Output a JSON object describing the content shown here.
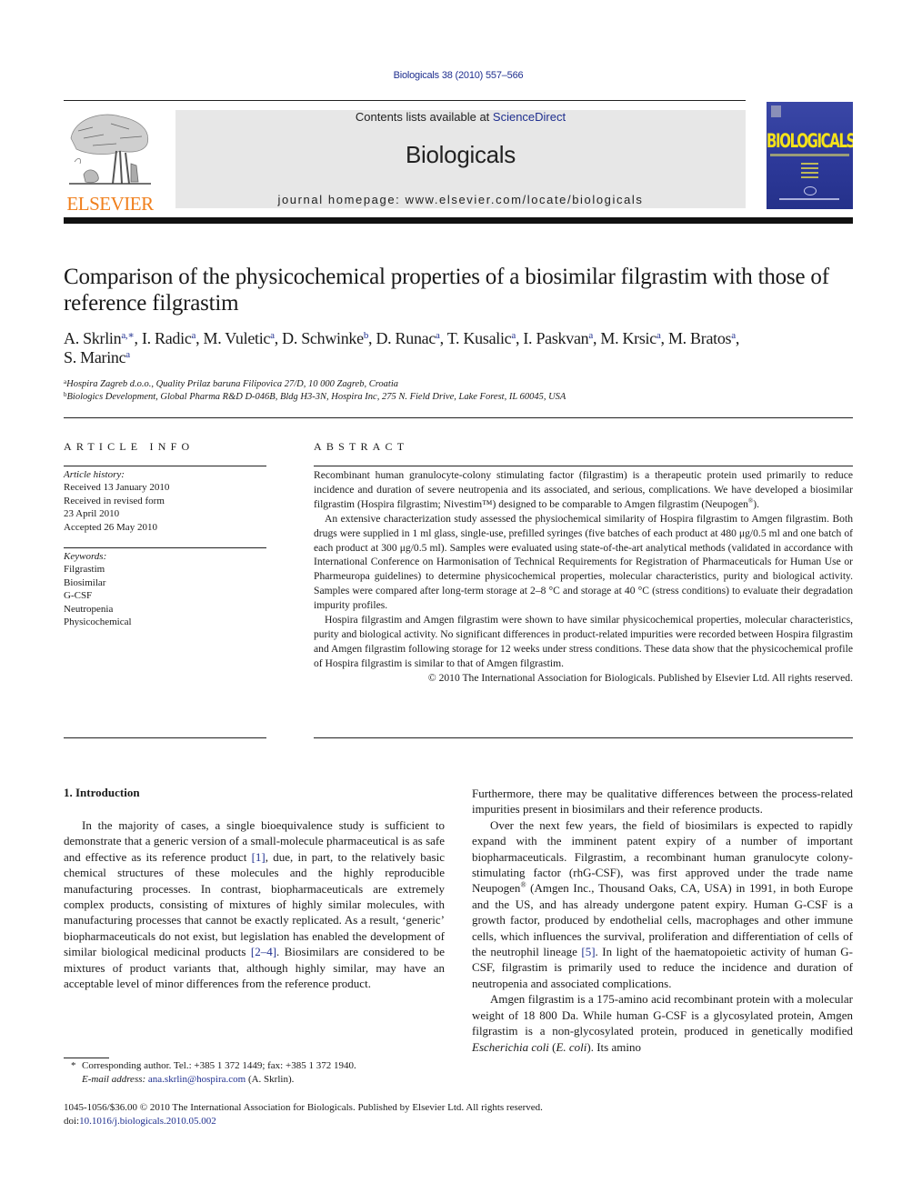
{
  "header": {
    "citation": "Biologicals 38 (2010) 557–566",
    "contents_prefix": "Contents lists available at ",
    "contents_link": "ScienceDirect",
    "journal_title": "Biologicals",
    "homepage": "journal homepage: www.elsevier.com/locate/biologicals",
    "publisher_logo_text": "ELSEVIER",
    "cover_title": "BIOLOGICALS"
  },
  "article": {
    "title": "Comparison of the physicochemical properties of a biosimilar filgrastim with those of reference filgrastim",
    "authors": [
      {
        "name": "A. Skrlin",
        "sup": "a,∗"
      },
      {
        "name": "I. Radic",
        "sup": "a"
      },
      {
        "name": "M. Vuletic",
        "sup": "a"
      },
      {
        "name": "D. Schwinke",
        "sup": "b"
      },
      {
        "name": "D. Runac",
        "sup": "a"
      },
      {
        "name": "T. Kusalic",
        "sup": "a"
      },
      {
        "name": "I. Paskvan",
        "sup": "a"
      },
      {
        "name": "M. Krsic",
        "sup": "a"
      },
      {
        "name": "M. Bratos",
        "sup": "a"
      },
      {
        "name": "S. Marinc",
        "sup": "a"
      }
    ],
    "affiliations": [
      {
        "mark": "a",
        "text": "Hospira Zagreb d.o.o., Quality Prilaz baruna Filipovica 27/D, 10 000 Zagreb, Croatia"
      },
      {
        "mark": "b",
        "text": "Biologics Development, Global Pharma R&D D-046B, Bldg H3-3N, Hospira Inc, 275 N. Field Drive, Lake Forest, IL 60045, USA"
      }
    ]
  },
  "article_info": {
    "heading": "ARTICLE INFO",
    "history_label": "Article history:",
    "history": [
      "Received 13 January 2010",
      "Received in revised form",
      "23 April 2010",
      "Accepted 26 May 2010"
    ],
    "keywords_label": "Keywords:",
    "keywords": [
      "Filgrastim",
      "Biosimilar",
      "G-CSF",
      "Neutropenia",
      "Physicochemical"
    ]
  },
  "abstract": {
    "heading": "ABSTRACT",
    "p1": "Recombinant human granulocyte-colony stimulating factor (filgrastim) is a therapeutic protein used primarily to reduce incidence and duration of severe neutropenia and its associated, and serious, complications. We have developed a biosimilar filgrastim (Hospira filgrastim; Nivestim™) designed to be comparable to Amgen filgrastim (Neupogen",
    "p1_reg": "®",
    "p1_end": ").",
    "p2": "An extensive characterization study assessed the physiochemical similarity of Hospira filgrastim to Amgen filgrastim. Both drugs were supplied in 1 ml glass, single-use, prefilled syringes (five batches of each product at 480 μg/0.5 ml and one batch of each product at 300 μg/0.5 ml). Samples were evaluated using state-of-the-art analytical methods (validated in accordance with International Conference on Harmonisation of Technical Requirements for Registration of Pharmaceuticals for Human Use or Phar­meuropa guidelines) to determine physicochemical properties, molecular characteristics, purity and biological activity. Samples were compared after long-term storage at 2–8 °C and storage at 40 °C (stress conditions) to evaluate their degradation impurity profiles.",
    "p3": "Hospira filgrastim and Amgen filgrastim were shown to have similar physicochemical properties, molecular characteristics, purity and biological activity. No significant differences in product-related impurities were recorded between Hospira filgrastim and Amgen filgrastim following storage for 12 weeks under stress conditions. These data show that the physicochemical profile of Hospira filgrastim is similar to that of Amgen filgrastim.",
    "copyright": "© 2010 The International Association for Biologicals. Published by Elsevier Ltd. All rights reserved."
  },
  "body": {
    "section_heading": "1.  Introduction",
    "col1_p1_a": "In the majority of cases, a single bioequivalence study is suffi­cient to demonstrate that a generic version of a small-molecule pharmaceutical is as safe and effective as its reference product ",
    "ref1": "[1]",
    "col1_p1_b": ", due, in part, to the relatively basic chemical structures of these molecules and the highly reproducible manufacturing processes. In contrast, biopharmaceuticals are extremely complex products, consisting of mixtures of highly similar molecules, with manufacturing processes that cannot be exactly replicated. As a result, ‘generic’ biopharmaceuticals do not exist, but legislation has enabled the development of similar biological medicinal products ",
    "ref2": "[2–4]",
    "col1_p1_c": ". Biosimilars are considered to be mixtures of product variants that, although highly similar, may have an acceptable level of minor differences from the reference product.",
    "col2_p0": "Furthermore, there may be qualitative differences between the process-related impurities present in biosimilars and their refer­ence products.",
    "col2_p1_a": "Over the next few years, the field of biosimilars is expected to rapidly expand with the imminent patent expiry of a number of important biopharmaceuticals. Filgrastim, a recombinant human granulocyte colony-stimulating factor (rhG-CSF), was first approved under the trade name Neupogen",
    "col2_p1_reg": "®",
    "col2_p1_b": " (Amgen Inc., Thousand Oaks, CA, USA) in 1991, in both Europe and the US, and has already undergone patent expiry. Human G-CSF is a growth factor, produced by endo­thelial cells, macrophages and other immune cells, which influences the survival, proliferation and differentiation of cells of the neutro­phil lineage ",
    "ref5": "[5]",
    "col2_p1_c": ". In light of the haematopoietic activity of human G-CSF, filgrastim is primarily used to reduce the incidence and duration of neutropenia and associated complications.",
    "col2_p2_a": "Amgen filgrastim is a 175-amino acid recombinant protein with a molecular weight of 18 800 Da. While human G-CSF is a glyco­sylated protein, Amgen filgrastim is a non-glycosylated protein, produced in genetically modified ",
    "col2_p2_ital1": "Escherichia coli",
    "col2_p2_mid": " (",
    "col2_p2_ital2": "E. coli",
    "col2_p2_end": "). Its amino"
  },
  "footnote": {
    "star": "*",
    "corresponding": "Corresponding author. Tel.: +385 1 372 1449; fax: +385 1 372 1940.",
    "email_label": "E-mail address:",
    "email": "ana.skrlin@hospira.com",
    "email_suffix": " (A. Skrlin)."
  },
  "bottom": {
    "issn_line": "1045-1056/$36.00 © 2010 The International Association for Biologicals. Published by Elsevier Ltd. All rights reserved.",
    "doi_label": "doi:",
    "doi": "10.1016/j.biologicals.2010.05.002"
  },
  "colors": {
    "link": "#1f2f8f",
    "elsevier_orange": "#f07f1c",
    "banner_gray": "#e7e7e7",
    "cover_blue": "#2c3898",
    "cover_yellow": "#f4e21a"
  }
}
